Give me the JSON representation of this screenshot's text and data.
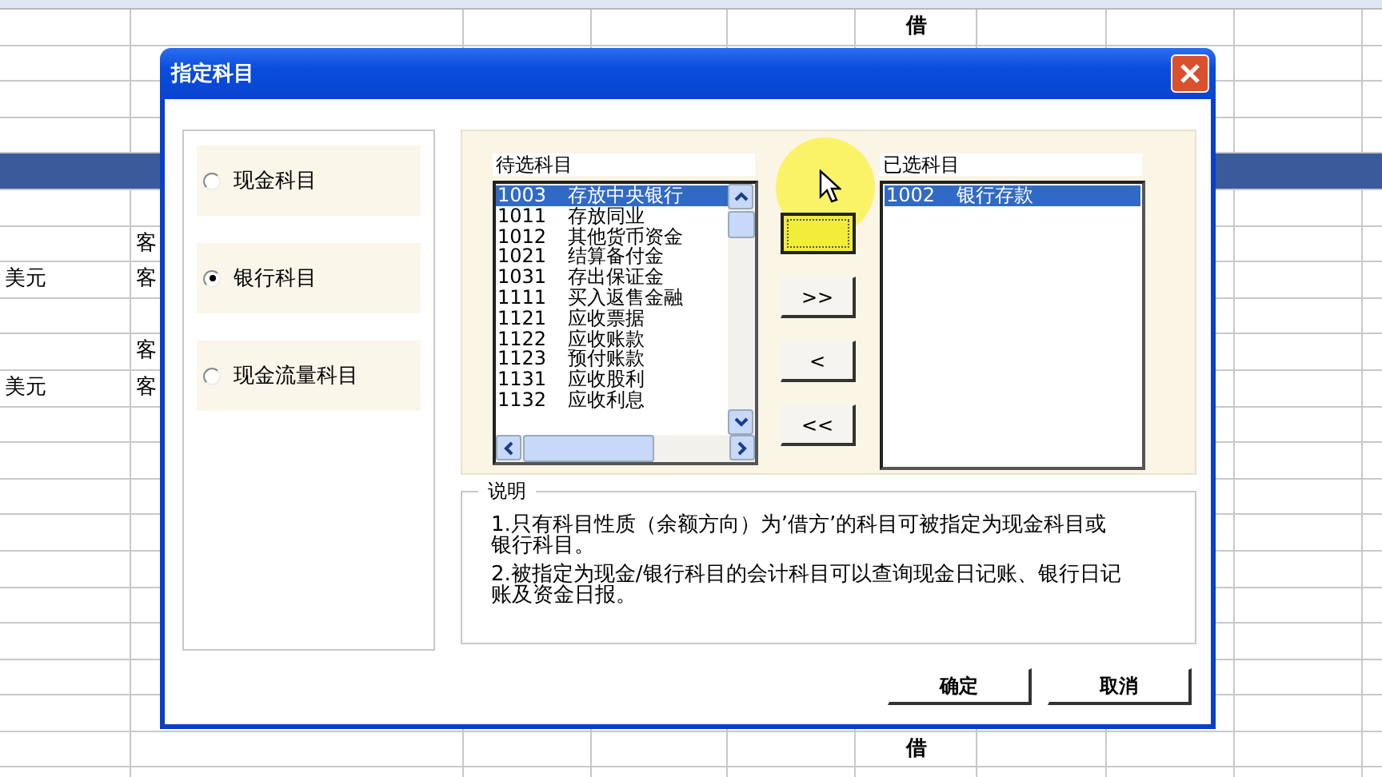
{
  "sheet": {
    "rows": [
      {
        "selected": false,
        "column_6": "借"
      },
      {
        "selected": false
      },
      {
        "selected": false
      },
      {
        "selected": false
      },
      {
        "selected": true
      },
      {
        "selected": false
      },
      {
        "selected": false,
        "column_2": "客"
      },
      {
        "selected": false,
        "column_1": "美元",
        "column_2": "客"
      },
      {
        "selected": false
      },
      {
        "selected": false,
        "column_2": "客"
      },
      {
        "selected": false,
        "column_1": "美元",
        "column_2": "客"
      },
      {
        "selected": false
      },
      {
        "selected": false
      },
      {
        "selected": false
      },
      {
        "selected": false
      },
      {
        "selected": false
      },
      {
        "selected": false
      },
      {
        "selected": false
      },
      {
        "selected": false
      },
      {
        "selected": false
      },
      {
        "selected": false,
        "column_6": "借"
      }
    ]
  },
  "dialog": {
    "title": "指定科目",
    "subject_types": [
      {
        "label": "现金科目",
        "selected": false
      },
      {
        "label": "银行科目",
        "selected": true
      },
      {
        "label": "现金流量科目",
        "selected": false
      }
    ],
    "available": {
      "label": "待选科目",
      "items": [
        {
          "code": "1003",
          "name": "存放中央银行",
          "selected": true
        },
        {
          "code": "1011",
          "name": "存放同业",
          "selected": false
        },
        {
          "code": "1012",
          "name": "其他货币资金",
          "selected": false
        },
        {
          "code": "1021",
          "name": "结算备付金",
          "selected": false
        },
        {
          "code": "1031",
          "name": "存出保证金",
          "selected": false
        },
        {
          "code": "1111",
          "name": "买入返售金融",
          "selected": false
        },
        {
          "code": "1121",
          "name": "应收票据",
          "selected": false
        },
        {
          "code": "1122",
          "name": "应收账款",
          "selected": false
        },
        {
          "code": "1123",
          "name": "预付账款",
          "selected": false
        },
        {
          "code": "1131",
          "name": "应收股利",
          "selected": false
        },
        {
          "code": "1132",
          "name": "应收利息",
          "selected": false
        }
      ]
    },
    "move_buttons": [
      {
        "kind": "focused"
      },
      {
        "label": ">>",
        "kind": "plain"
      },
      {
        "label": "<",
        "kind": "plain"
      },
      {
        "label": "<<",
        "kind": "plain"
      }
    ],
    "chosen": {
      "label": "已选科目",
      "items": [
        {
          "code": "1002",
          "name": "银行存款",
          "selected": true
        }
      ]
    },
    "notes": {
      "legend": "说明",
      "lines": [
        "1.只有科目性质（余额方向）为’借方’的科目可被指定为现金科目或银行科目。",
        "2.被指定为现金/银行科目的会计科目可以查询现金日记账、银行日记账及资金日报。"
      ]
    },
    "buttons": [
      "确定",
      "取消"
    ]
  }
}
